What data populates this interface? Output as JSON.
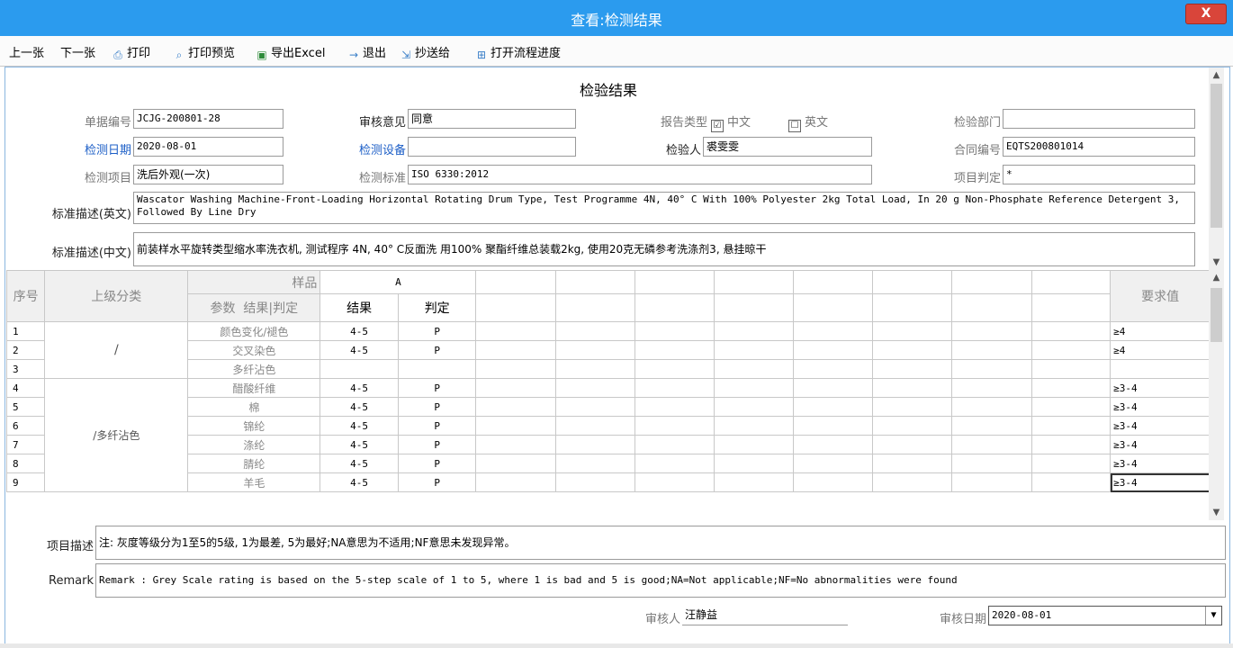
{
  "window": {
    "title": "查看:检测结果",
    "close_label": "X"
  },
  "toolbar": {
    "prev": "上一张",
    "next": "下一张",
    "print": "打印",
    "print_preview": "打印预览",
    "export_excel": "导出Excel",
    "exit": "退出",
    "cc": "抄送给",
    "open_flow": "打开流程进度"
  },
  "form": {
    "title": "检验结果",
    "doc_no_label": "单据编号",
    "doc_no": "JCJG-200801-28",
    "review_opinion_label": "审核意见",
    "review_opinion": "同意",
    "report_type_label": "报告类型",
    "report_cn": "中文",
    "report_en": "英文",
    "report_cn_checked": "☑",
    "report_en_checked": "☐",
    "dept_label": "检验部门",
    "dept": "",
    "test_date_label": "检测日期",
    "test_date": "2020-08-01",
    "equipment_label": "检测设备",
    "equipment": "",
    "inspector_label": "检验人",
    "inspector": "裘雯雯",
    "contract_no_label": "合同编号",
    "contract_no": "EQTS200801014",
    "test_item_label": "检测项目",
    "test_item": "洗后外观(一次)",
    "standard_label": "检测标准",
    "standard": "ISO 6330:2012",
    "judgement_label": "项目判定",
    "judgement": "*",
    "desc_en_label": "标准描述(英文)",
    "desc_en": "Wascator Washing Machine-Front-Loading Horizontal Rotating Drum Type, Test Programme 4N, 40° C With 100% Polyester 2kg Total Load, In 20 g Non-Phosphate Reference Detergent 3, Followed By Line Dry",
    "desc_cn_label": "标准描述(中文)",
    "desc_cn": "前装样水平旋转类型缩水率洗衣机, 测试程序 4N, 40° C反面洗 用100% 聚酯纤维总装载2kg, 使用20克无磷参考洗涤剂3, 悬挂晾干"
  },
  "grid": {
    "headers": {
      "seq": "序号",
      "category": "上级分类",
      "sample": "样品",
      "param": "参数",
      "result_judge": "结果|判定",
      "sample_a": "A",
      "result": "结果",
      "judge": "判定",
      "required": "要求值"
    },
    "rows": [
      {
        "seq": "1",
        "param": "颜色变化/褪色",
        "result": "4-5",
        "judge": "P",
        "req": "≥4"
      },
      {
        "seq": "2",
        "param": "交叉染色",
        "result": "4-5",
        "judge": "P",
        "req": "≥4"
      },
      {
        "seq": "3",
        "param": "多纤沾色",
        "result": "",
        "judge": "",
        "req": ""
      },
      {
        "seq": "4",
        "param": "醋酸纤维",
        "result": "4-5",
        "judge": "P",
        "req": "≥3-4"
      },
      {
        "seq": "5",
        "param": "棉",
        "result": "4-5",
        "judge": "P",
        "req": "≥3-4"
      },
      {
        "seq": "6",
        "param": "锦纶",
        "result": "4-5",
        "judge": "P",
        "req": "≥3-4"
      },
      {
        "seq": "7",
        "param": "涤纶",
        "result": "4-5",
        "judge": "P",
        "req": "≥3-4"
      },
      {
        "seq": "8",
        "param": "腈纶",
        "result": "4-5",
        "judge": "P",
        "req": "≥3-4"
      },
      {
        "seq": "9",
        "param": "羊毛",
        "result": "4-5",
        "judge": "P",
        "req": "≥3-4"
      }
    ],
    "cat_group1": "/",
    "cat_group2": "/多纤沾色"
  },
  "footer": {
    "item_desc_label": "项目描述",
    "item_desc": "注: 灰度等级分为1至5的5级, 1为最差, 5为最好;NA意思为不适用;NF意思未发现异常。",
    "remark_label": "Remark",
    "remark": "Remark : Grey Scale rating is based on the 5-step scale of 1 to 5, where 1 is bad and 5 is good;NA=Not applicable;NF=No abnormalities were found",
    "reviewer_label": "审核人",
    "reviewer": "汪静益",
    "review_date_label": "审核日期",
    "review_date": "2020-08-01"
  },
  "icons": {
    "print": "printer-icon",
    "preview": "magnifier-icon",
    "excel": "excel-icon",
    "exit": "arrow-right-icon",
    "cc": "forward-icon",
    "flow": "grid-icon"
  }
}
